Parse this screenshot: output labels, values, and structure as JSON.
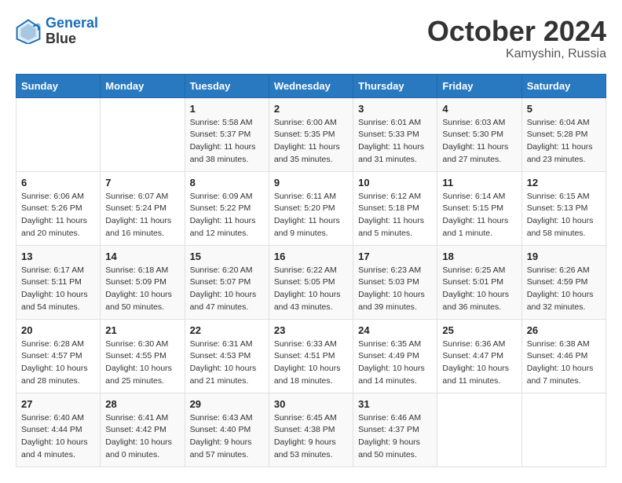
{
  "logo": {
    "line1": "General",
    "line2": "Blue"
  },
  "title": "October 2024",
  "location": "Kamyshin, Russia",
  "weekdays": [
    "Sunday",
    "Monday",
    "Tuesday",
    "Wednesday",
    "Thursday",
    "Friday",
    "Saturday"
  ],
  "weeks": [
    [
      {
        "day": "",
        "info": ""
      },
      {
        "day": "",
        "info": ""
      },
      {
        "day": "1",
        "info": "Sunrise: 5:58 AM\nSunset: 5:37 PM\nDaylight: 11 hours and 38 minutes."
      },
      {
        "day": "2",
        "info": "Sunrise: 6:00 AM\nSunset: 5:35 PM\nDaylight: 11 hours and 35 minutes."
      },
      {
        "day": "3",
        "info": "Sunrise: 6:01 AM\nSunset: 5:33 PM\nDaylight: 11 hours and 31 minutes."
      },
      {
        "day": "4",
        "info": "Sunrise: 6:03 AM\nSunset: 5:30 PM\nDaylight: 11 hours and 27 minutes."
      },
      {
        "day": "5",
        "info": "Sunrise: 6:04 AM\nSunset: 5:28 PM\nDaylight: 11 hours and 23 minutes."
      }
    ],
    [
      {
        "day": "6",
        "info": "Sunrise: 6:06 AM\nSunset: 5:26 PM\nDaylight: 11 hours and 20 minutes."
      },
      {
        "day": "7",
        "info": "Sunrise: 6:07 AM\nSunset: 5:24 PM\nDaylight: 11 hours and 16 minutes."
      },
      {
        "day": "8",
        "info": "Sunrise: 6:09 AM\nSunset: 5:22 PM\nDaylight: 11 hours and 12 minutes."
      },
      {
        "day": "9",
        "info": "Sunrise: 6:11 AM\nSunset: 5:20 PM\nDaylight: 11 hours and 9 minutes."
      },
      {
        "day": "10",
        "info": "Sunrise: 6:12 AM\nSunset: 5:18 PM\nDaylight: 11 hours and 5 minutes."
      },
      {
        "day": "11",
        "info": "Sunrise: 6:14 AM\nSunset: 5:15 PM\nDaylight: 11 hours and 1 minute."
      },
      {
        "day": "12",
        "info": "Sunrise: 6:15 AM\nSunset: 5:13 PM\nDaylight: 10 hours and 58 minutes."
      }
    ],
    [
      {
        "day": "13",
        "info": "Sunrise: 6:17 AM\nSunset: 5:11 PM\nDaylight: 10 hours and 54 minutes."
      },
      {
        "day": "14",
        "info": "Sunrise: 6:18 AM\nSunset: 5:09 PM\nDaylight: 10 hours and 50 minutes."
      },
      {
        "day": "15",
        "info": "Sunrise: 6:20 AM\nSunset: 5:07 PM\nDaylight: 10 hours and 47 minutes."
      },
      {
        "day": "16",
        "info": "Sunrise: 6:22 AM\nSunset: 5:05 PM\nDaylight: 10 hours and 43 minutes."
      },
      {
        "day": "17",
        "info": "Sunrise: 6:23 AM\nSunset: 5:03 PM\nDaylight: 10 hours and 39 minutes."
      },
      {
        "day": "18",
        "info": "Sunrise: 6:25 AM\nSunset: 5:01 PM\nDaylight: 10 hours and 36 minutes."
      },
      {
        "day": "19",
        "info": "Sunrise: 6:26 AM\nSunset: 4:59 PM\nDaylight: 10 hours and 32 minutes."
      }
    ],
    [
      {
        "day": "20",
        "info": "Sunrise: 6:28 AM\nSunset: 4:57 PM\nDaylight: 10 hours and 28 minutes."
      },
      {
        "day": "21",
        "info": "Sunrise: 6:30 AM\nSunset: 4:55 PM\nDaylight: 10 hours and 25 minutes."
      },
      {
        "day": "22",
        "info": "Sunrise: 6:31 AM\nSunset: 4:53 PM\nDaylight: 10 hours and 21 minutes."
      },
      {
        "day": "23",
        "info": "Sunrise: 6:33 AM\nSunset: 4:51 PM\nDaylight: 10 hours and 18 minutes."
      },
      {
        "day": "24",
        "info": "Sunrise: 6:35 AM\nSunset: 4:49 PM\nDaylight: 10 hours and 14 minutes."
      },
      {
        "day": "25",
        "info": "Sunrise: 6:36 AM\nSunset: 4:47 PM\nDaylight: 10 hours and 11 minutes."
      },
      {
        "day": "26",
        "info": "Sunrise: 6:38 AM\nSunset: 4:46 PM\nDaylight: 10 hours and 7 minutes."
      }
    ],
    [
      {
        "day": "27",
        "info": "Sunrise: 6:40 AM\nSunset: 4:44 PM\nDaylight: 10 hours and 4 minutes."
      },
      {
        "day": "28",
        "info": "Sunrise: 6:41 AM\nSunset: 4:42 PM\nDaylight: 10 hours and 0 minutes."
      },
      {
        "day": "29",
        "info": "Sunrise: 6:43 AM\nSunset: 4:40 PM\nDaylight: 9 hours and 57 minutes."
      },
      {
        "day": "30",
        "info": "Sunrise: 6:45 AM\nSunset: 4:38 PM\nDaylight: 9 hours and 53 minutes."
      },
      {
        "day": "31",
        "info": "Sunrise: 6:46 AM\nSunset: 4:37 PM\nDaylight: 9 hours and 50 minutes."
      },
      {
        "day": "",
        "info": ""
      },
      {
        "day": "",
        "info": ""
      }
    ]
  ]
}
